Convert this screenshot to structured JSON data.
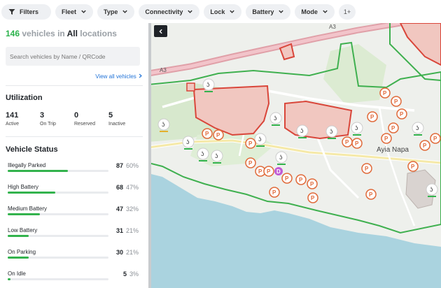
{
  "filters": {
    "items": [
      {
        "label": "Filters"
      },
      {
        "label": "Fleet"
      },
      {
        "label": "Type"
      },
      {
        "label": "Connectivity"
      },
      {
        "label": "Lock"
      },
      {
        "label": "Battery"
      },
      {
        "label": "Mode"
      }
    ],
    "more": "1+"
  },
  "sidebar": {
    "count": "146",
    "count_mid": " vehicles in ",
    "location": "All",
    "count_suffix": " locations",
    "search_placeholder": "Search vehicles by Name / QRCode",
    "view_all": "View all vehicles",
    "utilization": {
      "title": "Utilization",
      "items": [
        {
          "value": "141",
          "label": "Active"
        },
        {
          "value": "3",
          "label": "On Trip"
        },
        {
          "value": "0",
          "label": "Reserved"
        },
        {
          "value": "5",
          "label": "Inactive"
        }
      ]
    },
    "status": {
      "title": "Vehicle Status",
      "items": [
        {
          "label": "Illegally Parked",
          "count": "87",
          "pct": "60%",
          "fill": 0.6
        },
        {
          "label": "High Battery",
          "count": "68",
          "pct": "47%",
          "fill": 0.47
        },
        {
          "label": "Medium Battery",
          "count": "47",
          "pct": "32%",
          "fill": 0.32
        },
        {
          "label": "Low Battery",
          "count": "31",
          "pct": "21%",
          "fill": 0.21
        },
        {
          "label": "On Parking",
          "count": "30",
          "pct": "21%",
          "fill": 0.21
        },
        {
          "label": "On Idle",
          "count": "5",
          "pct": "3%",
          "fill": 0.03
        }
      ]
    }
  },
  "map": {
    "road_labels": [
      "A3",
      "A3",
      "Ayia Napa"
    ],
    "colors": {
      "zone_green": "#3fb04f",
      "zone_red": "#d9463a",
      "sea": "#aad3df",
      "highway": "#e0a0a8"
    }
  }
}
